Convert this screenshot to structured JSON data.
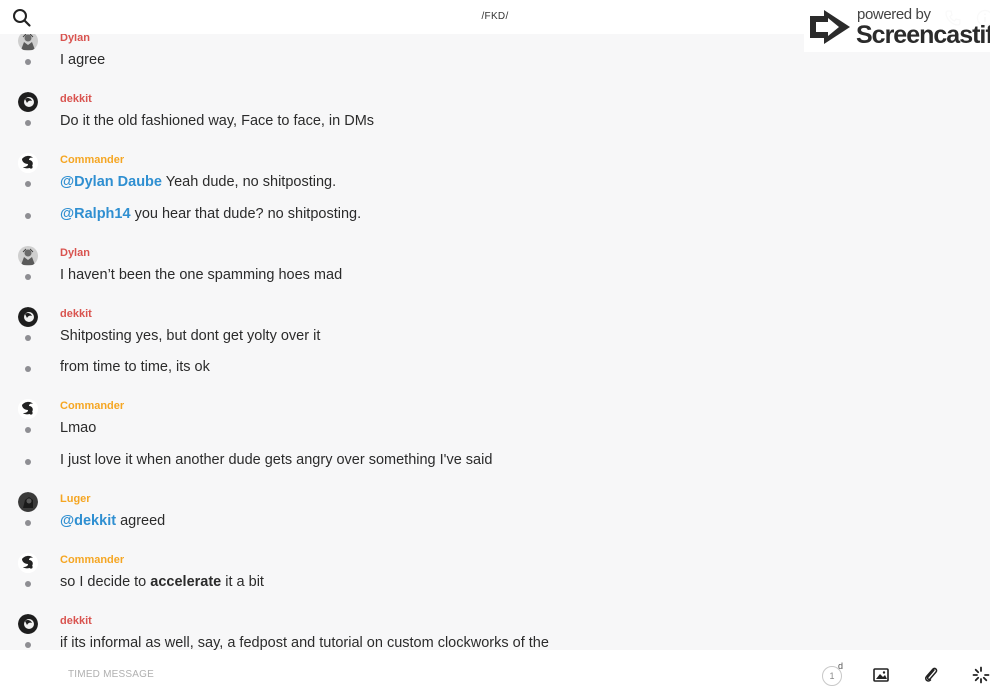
{
  "header": {
    "title": "/FKD/"
  },
  "watermark": {
    "powered": "powered by",
    "brand": "Screencastify"
  },
  "colors": {
    "dylan": "#d9534f",
    "dekkit": "#d9534f",
    "commander": "#f5a623",
    "luger": "#f5a623",
    "mention": "#2f8fd1"
  },
  "messages": [
    {
      "author": "Dylan",
      "avatar": "dylan-avatar",
      "lines": [
        "I agree"
      ]
    },
    {
      "author": "dekkit",
      "avatar": "dekkit-avatar",
      "lines": [
        "Do it the old fashioned way, Face to face, in DMs"
      ]
    },
    {
      "author": "Commander",
      "avatar": "commander-avatar",
      "lines": [
        {
          "mention": "@Dylan Daube",
          "rest": " Yeah dude, no shitposting."
        },
        {
          "mention": "@Ralph14",
          "rest": " you hear that dude? no shitposting."
        }
      ]
    },
    {
      "author": "Dylan",
      "avatar": "dylan-avatar",
      "lines": [
        "I haven’t been the one spamming hoes mad"
      ]
    },
    {
      "author": "dekkit",
      "avatar": "dekkit-avatar",
      "lines": [
        "Shitposting yes, but dont get yolty over it",
        "from time to time, its ok"
      ]
    },
    {
      "author": "Commander",
      "avatar": "commander-avatar",
      "lines": [
        "Lmao",
        "I just love it when another dude gets angry over something I've said"
      ]
    },
    {
      "author": "Luger",
      "avatar": "luger-avatar",
      "lines": [
        {
          "mention": "@dekkit",
          "rest": " agreed"
        }
      ]
    },
    {
      "author": "Commander",
      "avatar": "commander-avatar",
      "lines": [
        {
          "pre": "so I decide to ",
          "bold": "accelerate",
          "rest": " it a bit"
        }
      ]
    },
    {
      "author": "dekkit",
      "avatar": "dekkit-avatar",
      "lines": [
        "if its informal as well, say, a fedpost and tutorial on custom clockworks of the"
      ]
    }
  ],
  "composer": {
    "placeholder": "TIMED MESSAGE",
    "timer_value": "1",
    "timer_unit": "d"
  }
}
